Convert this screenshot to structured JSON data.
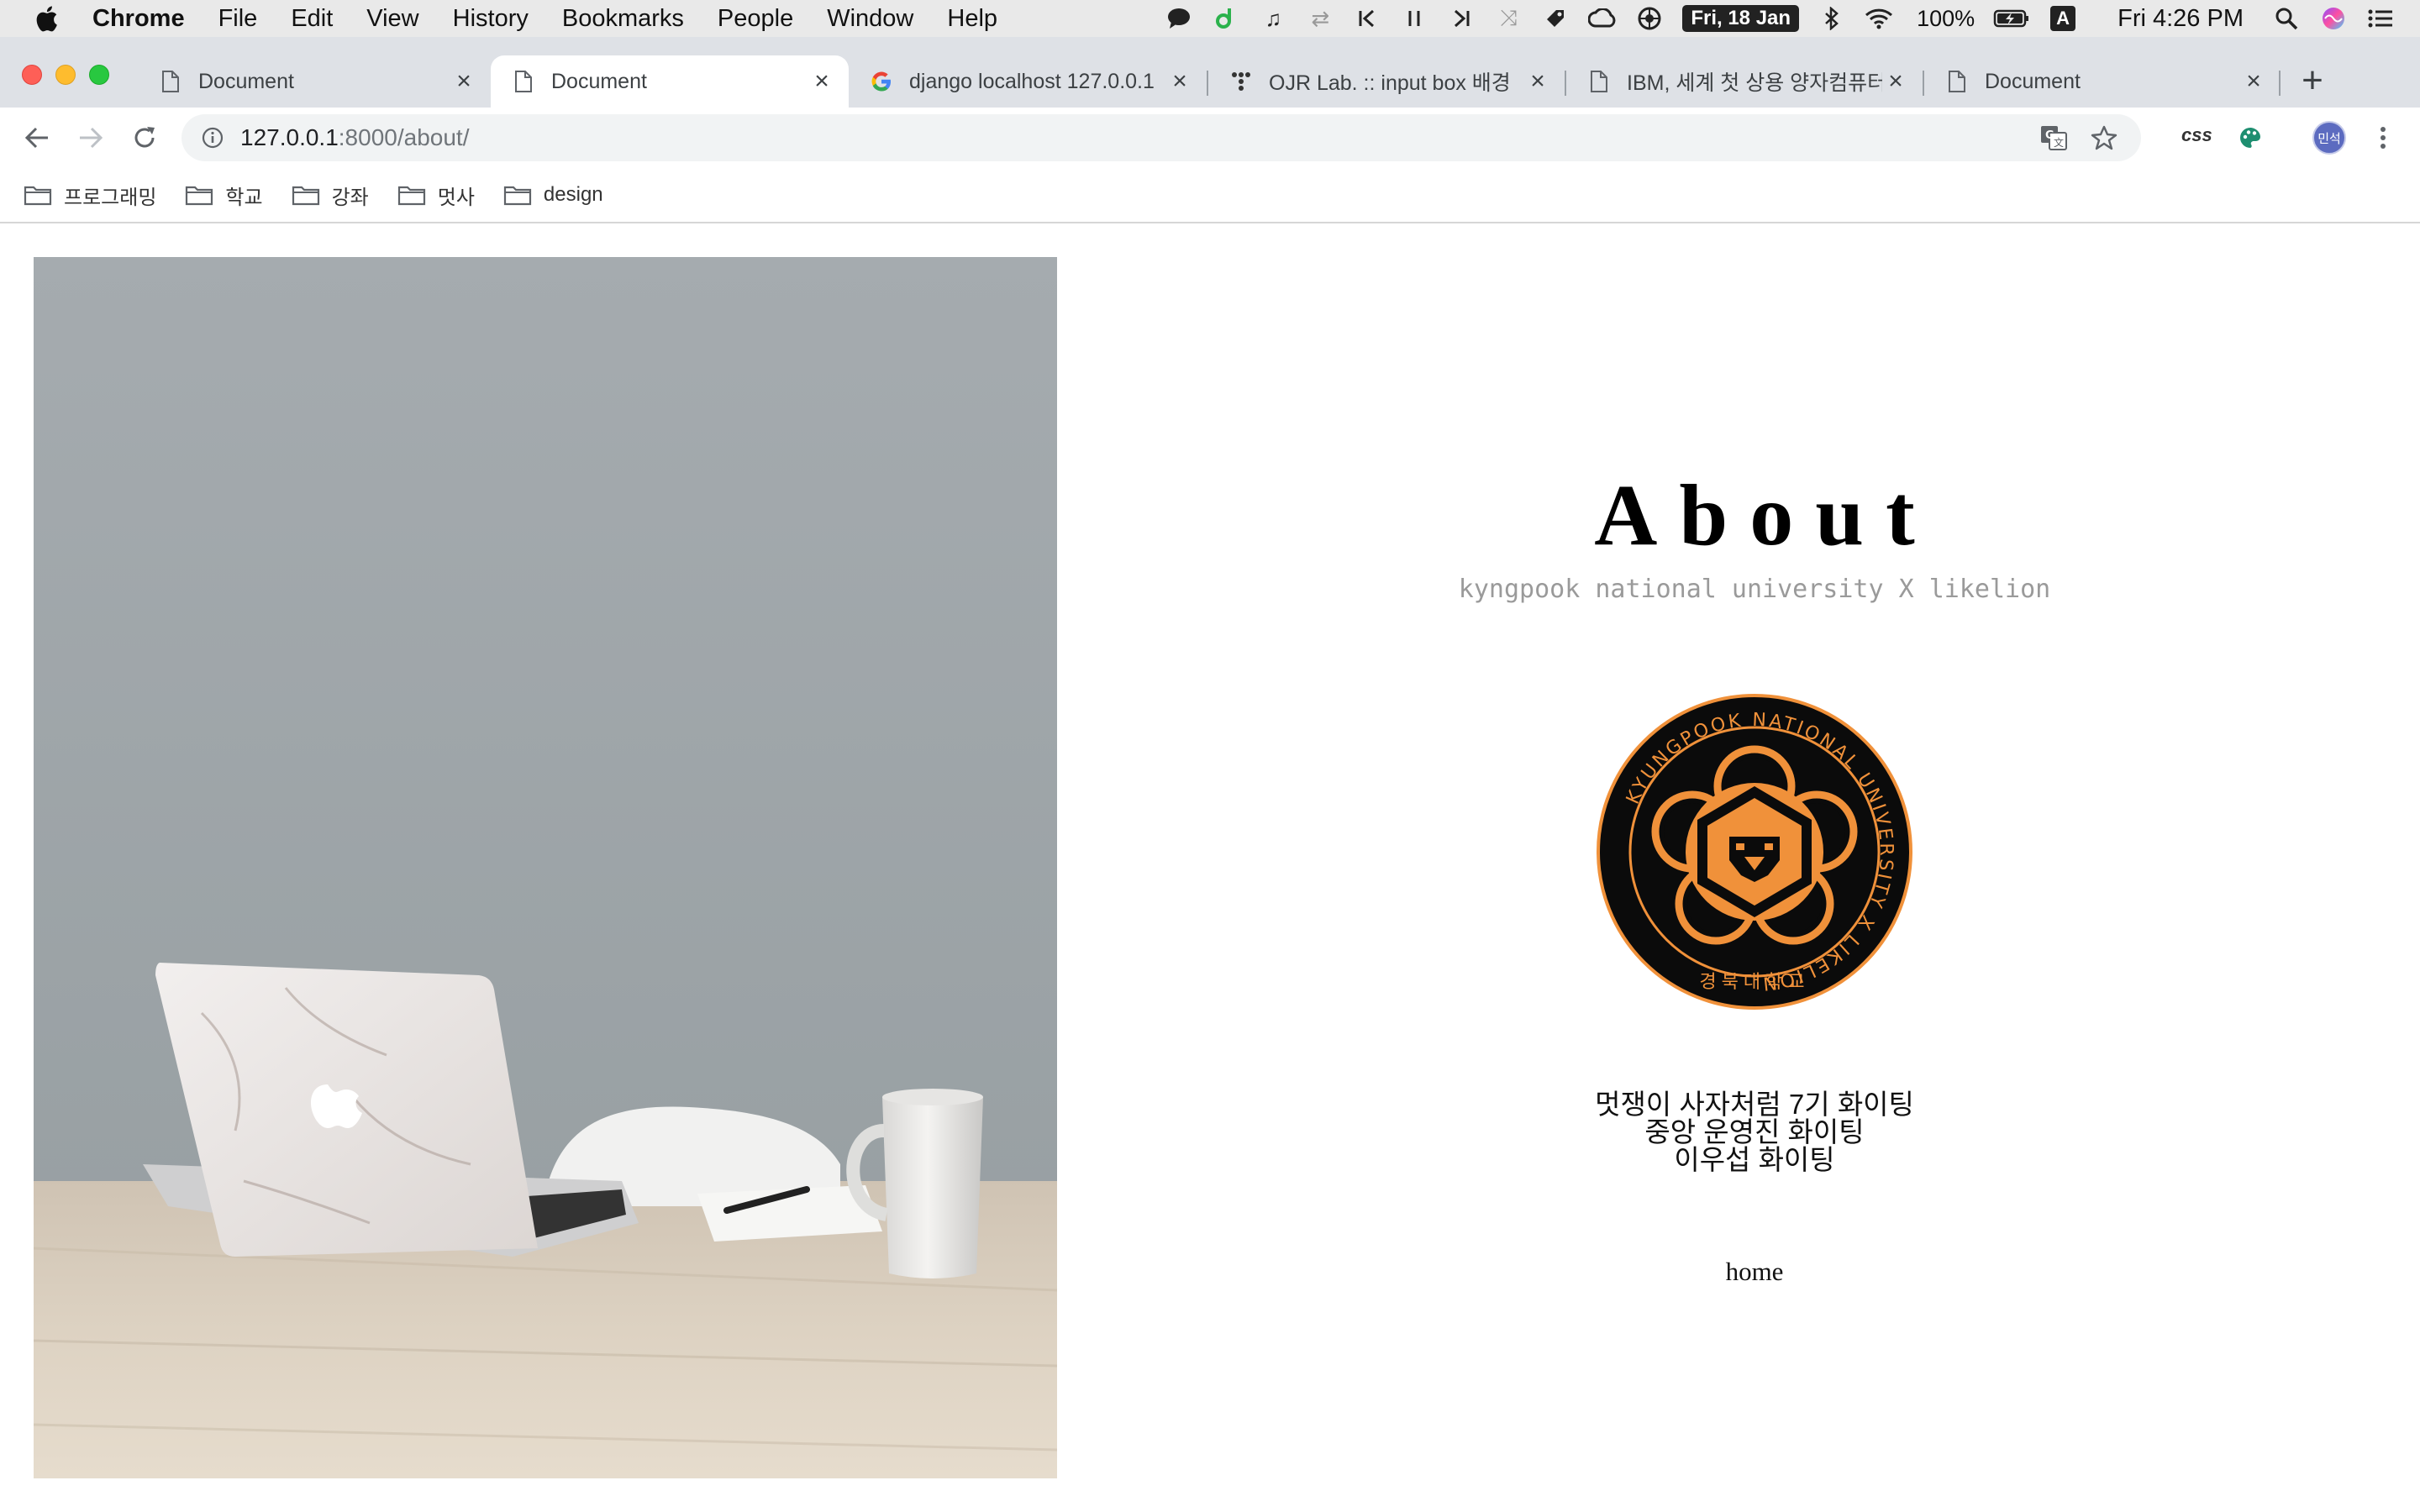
{
  "menubar": {
    "app_name": "Chrome",
    "items": [
      "File",
      "Edit",
      "View",
      "History",
      "Bookmarks",
      "People",
      "Window",
      "Help"
    ],
    "date_badge": "Fri, 18 Jan",
    "battery": "100%",
    "input_source": "A",
    "clock": "Fri 4:26 PM"
  },
  "tabs": [
    {
      "title": "Document",
      "icon": "page-icon",
      "active": false
    },
    {
      "title": "Document",
      "icon": "page-icon",
      "active": true
    },
    {
      "title": "django localhost 127.0.0.1",
      "icon": "google-icon",
      "active": false
    },
    {
      "title": "OJR Lab. :: input box 배경",
      "icon": "tistory-icon",
      "active": false
    },
    {
      "title": "IBM, 세계 첫 상용 양자컴퓨터",
      "icon": "page-icon",
      "active": false
    },
    {
      "title": "Document",
      "icon": "page-icon",
      "active": false
    }
  ],
  "toolbar": {
    "url_host": "127.0.0.1",
    "url_path": ":8000/about/",
    "extension_label": "css",
    "profile_initials": "민석"
  },
  "bookmarks": [
    {
      "label": "프로그래밍",
      "icon": "folder-icon"
    },
    {
      "label": "학교",
      "icon": "folder-icon"
    },
    {
      "label": "강좌",
      "icon": "folder-icon"
    },
    {
      "label": "멋사",
      "icon": "folder-icon"
    },
    {
      "label": "design",
      "icon": "folder-icon"
    }
  ],
  "page": {
    "title": "About",
    "subtitle": "kyngpook national university X likelion",
    "emblem": {
      "ring_text": "KYUNGPOOK NATIONAL UNIVERSITY X LIKELION",
      "bottom_text": "경북대학교",
      "colors": {
        "background": "#0b0b0b",
        "accent": "#f0913a"
      }
    },
    "message_lines": [
      "멋쟁이 사자처럼 7기 화이팅",
      "중앙 운영진 화이팅",
      "이우섭 화이팅"
    ],
    "home_link": "home"
  },
  "colors": {
    "tabstrip": "#dee1e6",
    "omnibox": "#f1f3f4",
    "accent_orange": "#f0913a"
  }
}
